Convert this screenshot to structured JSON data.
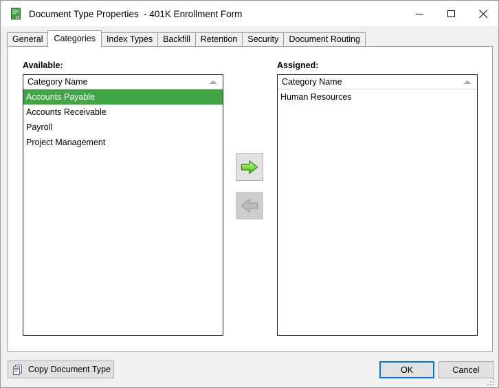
{
  "window": {
    "title": "Document Type Properties  - 401K Enrollment Form",
    "icon": "document-lock-icon",
    "controls": {
      "minimize": "minimize-icon",
      "maximize": "maximize-icon",
      "close": "close-icon"
    }
  },
  "tabs": [
    {
      "label": "General",
      "selected": false
    },
    {
      "label": "Categories",
      "selected": true
    },
    {
      "label": "Index Types",
      "selected": false
    },
    {
      "label": "Backfill",
      "selected": false
    },
    {
      "label": "Retention",
      "selected": false
    },
    {
      "label": "Security",
      "selected": false
    },
    {
      "label": "Document Routing",
      "selected": false
    }
  ],
  "available": {
    "label": "Available:",
    "column_header": "Category Name",
    "sort": "ascending",
    "rows": [
      {
        "name": "Accounts Payable",
        "selected": true
      },
      {
        "name": "Accounts Receivable",
        "selected": false
      },
      {
        "name": "Payroll",
        "selected": false
      },
      {
        "name": "Project Management",
        "selected": false
      }
    ]
  },
  "assigned": {
    "label": "Assigned:",
    "column_header": "Category Name",
    "sort": "ascending",
    "rows": [
      {
        "name": "Human Resources",
        "selected": false
      }
    ]
  },
  "transfer": {
    "move_right": {
      "icon": "arrow-right-icon",
      "enabled": true,
      "title": "Assign"
    },
    "move_left": {
      "icon": "arrow-left-icon",
      "enabled": false,
      "title": "Unassign"
    }
  },
  "footer": {
    "copy_label": "Copy Document Type",
    "copy_icon": "copy-documents-icon",
    "ok_label": "OK",
    "cancel_label": "Cancel"
  },
  "colors": {
    "selection_green": "#41a545",
    "accent_blue": "#0078d7",
    "arrow_green_light": "#a8e85c",
    "arrow_green_dark": "#2f9e1f",
    "button_face": "#e1e1e1",
    "dialog_face": "#f0f0f0"
  }
}
